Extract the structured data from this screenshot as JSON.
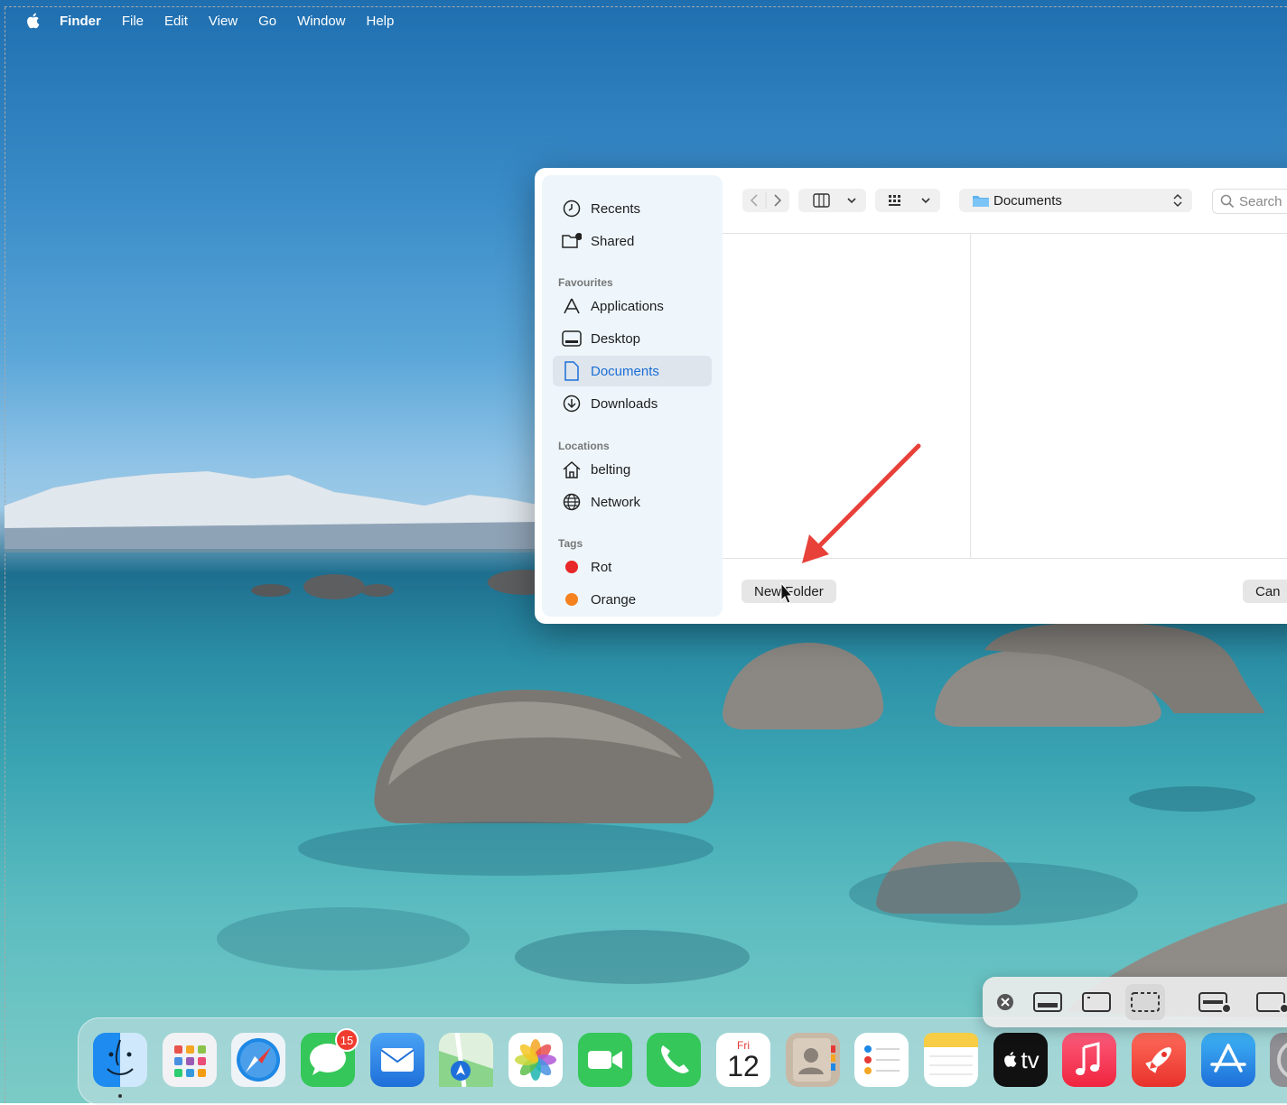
{
  "menubar": {
    "app_name": "Finder",
    "items": [
      "File",
      "Edit",
      "View",
      "Go",
      "Window",
      "Help"
    ]
  },
  "dialog": {
    "sidebar": {
      "top_items": [
        "Recents",
        "Shared"
      ],
      "favourites_heading": "Favourites",
      "favourites": [
        "Applications",
        "Desktop",
        "Documents",
        "Downloads"
      ],
      "selected": "Documents",
      "locations_heading": "Locations",
      "locations": [
        "belting",
        "Network"
      ],
      "tags_heading": "Tags",
      "tags": [
        {
          "label": "Rot",
          "color": "#e8272a"
        },
        {
          "label": "Orange",
          "color": "#f5821f"
        }
      ]
    },
    "toolbar": {
      "path_label": "Documents",
      "search_placeholder": "Search"
    },
    "buttons": {
      "new_folder": "New Folder",
      "cancel": "Can"
    }
  },
  "annotation": {
    "arrow_color": "#e8413a"
  },
  "dock": {
    "apps": [
      "Finder",
      "Launchpad",
      "Safari",
      "Messages",
      "Mail",
      "Maps",
      "Photos",
      "FaceTime",
      "Phone",
      "Calendar",
      "Contacts",
      "Reminders",
      "Notes",
      "TV",
      "Music",
      "Launcher",
      "App Store",
      "System Settings"
    ],
    "messages_badge": "15",
    "calendar_day_name": "Fri",
    "calendar_day_number": "12",
    "tv_label": "tv"
  },
  "capture_toolbar": {
    "buttons": [
      "close-capture",
      "capture-window-bar",
      "capture-window",
      "capture-selection",
      "record-screen",
      "record-selection"
    ]
  }
}
